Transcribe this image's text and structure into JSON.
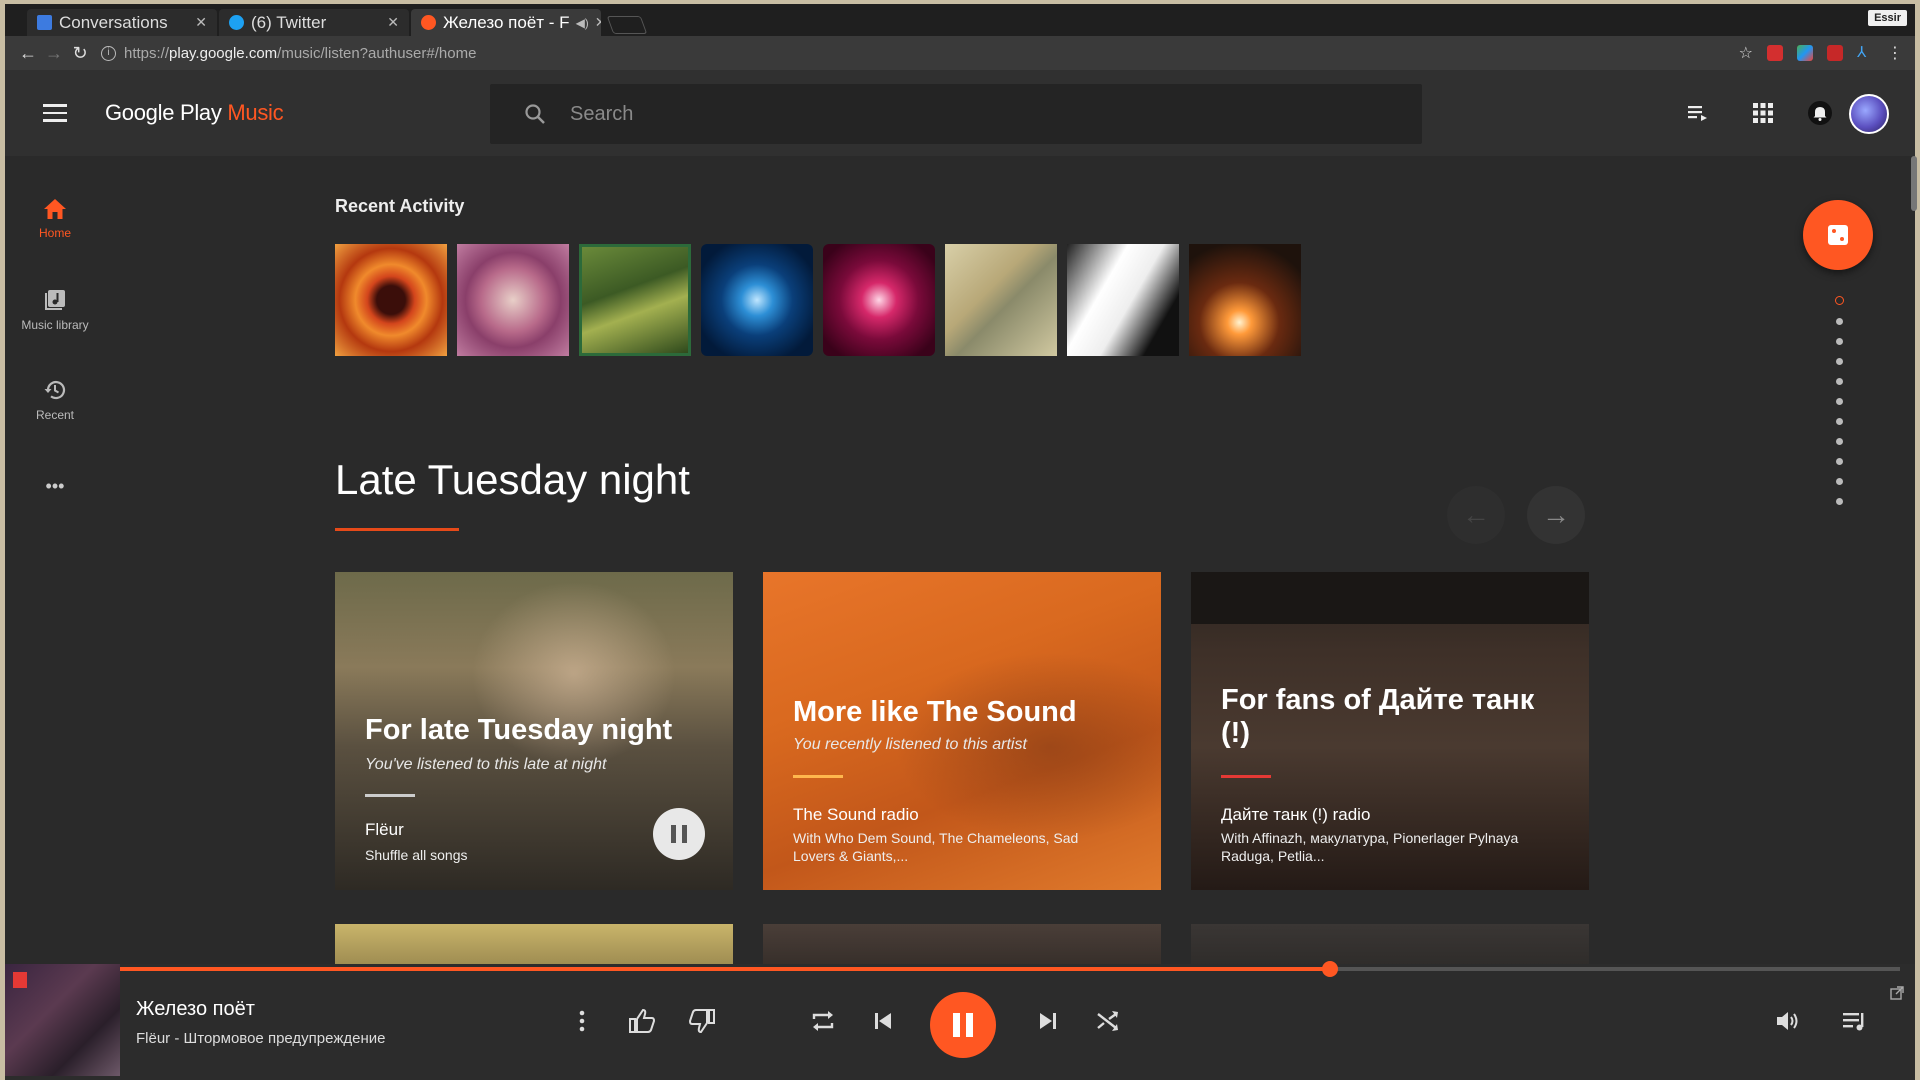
{
  "browser": {
    "tabs": [
      {
        "title": "Conversations"
      },
      {
        "title": "(6) Twitter"
      },
      {
        "title": "Железо поёт - F"
      }
    ],
    "profile": "Essir",
    "url_scheme": "https://",
    "url_host": "play.google.com",
    "url_path": "/music/listen?authuser#/home"
  },
  "header": {
    "logo_main": "Google Play",
    "logo_accent": "Music",
    "search_placeholder": "Search"
  },
  "nav": {
    "items": [
      {
        "label": "Home"
      },
      {
        "label": "Music library"
      },
      {
        "label": "Recent"
      }
    ],
    "more": "•••"
  },
  "recent": {
    "title": "Recent Activity"
  },
  "section": {
    "title": "Late Tuesday night"
  },
  "cards": [
    {
      "title": "For late Tuesday night",
      "subtitle": "You've listened to this late at night",
      "name": "Flëur",
      "desc": "Shuffle all songs"
    },
    {
      "title": "More like The Sound",
      "subtitle": "You recently listened to this artist",
      "name": "The Sound radio",
      "desc": "With Who Dem Sound, The Chameleons, Sad Lovers & Giants,..."
    },
    {
      "title": "For fans of Дайте танк (!)",
      "subtitle": "",
      "name": "Дайте танк (!) radio",
      "desc": "With Affinazh, макулатура, Pionerlager Pylnaya Raduga, Petlia..."
    }
  ],
  "player": {
    "title": "Железо поёт",
    "subtitle": "Flëur - Штормовое предупреждение",
    "progress": 0.68
  },
  "colors": {
    "accent": "#ff5722",
    "background": "#2a2a2a",
    "header": "#303030"
  }
}
